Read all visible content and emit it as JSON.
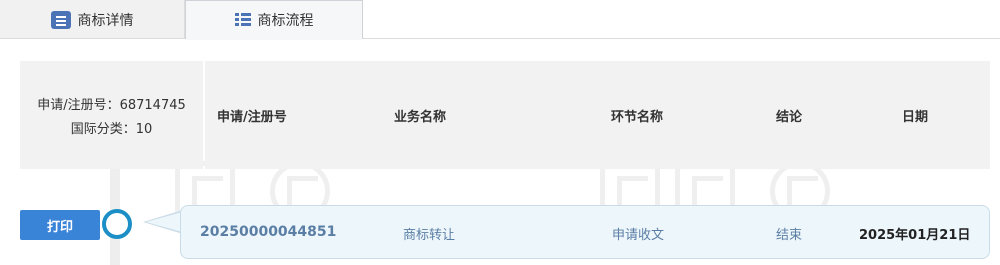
{
  "tabs": [
    {
      "label": "商标详情",
      "icon": "document-icon",
      "active": false
    },
    {
      "label": "商标流程",
      "icon": "list-icon",
      "active": true
    }
  ],
  "info": {
    "reg_line": "申请/注册号：68714745",
    "class_line": "国际分类：10"
  },
  "table": {
    "headers": [
      "申请/注册号",
      "业务名称",
      "环节名称",
      "结论",
      "日期"
    ],
    "rows": [
      {
        "reg_no": "20250000044851",
        "business": "商标转让",
        "step": "申请收文",
        "result": "结束",
        "date": "2025年01月21日"
      }
    ]
  },
  "print_label": "打印",
  "colors": {
    "accent": "#3a84d7",
    "node": "#1d8fc7",
    "row_bg": "#edf6fb",
    "row_text": "#5b7ea4"
  }
}
